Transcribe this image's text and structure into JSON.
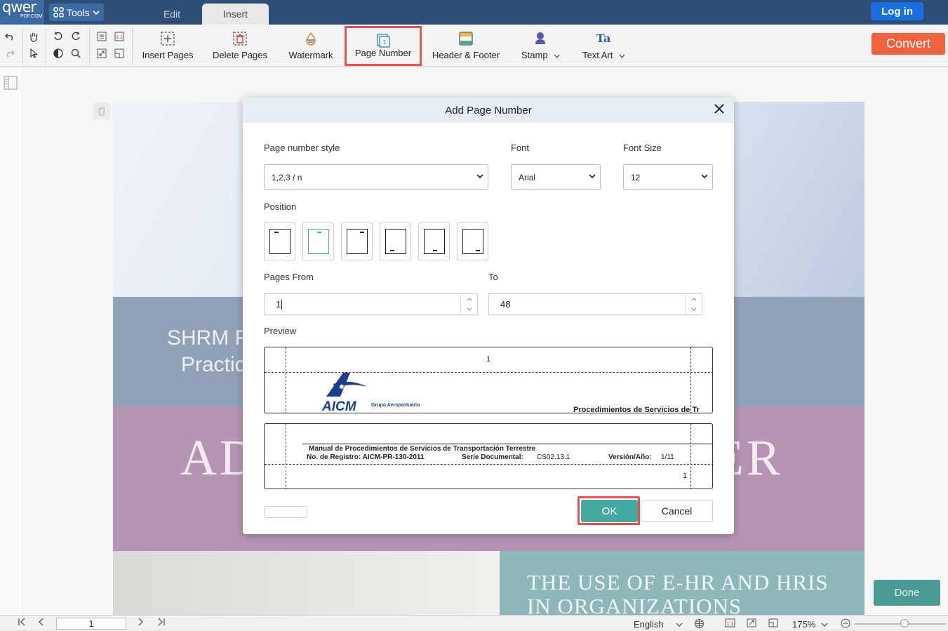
{
  "app": {
    "logo_text": "qwer",
    "logo_sub": "PDF.COM",
    "tools_label": "Tools",
    "tabs": [
      {
        "label": "Edit"
      },
      {
        "label": "Insert"
      }
    ],
    "login_label": "Log in",
    "convert_label": "Convert"
  },
  "toolbar": {
    "insert_pages": "Insert Pages",
    "delete_pages": "Delete Pages",
    "watermark": "Watermark",
    "page_number": "Page Number",
    "header_footer": "Header & Footer",
    "stamp": "Stamp",
    "text_art": "Text Art",
    "text_art_icon_text": "Ta"
  },
  "document": {
    "shrm_line1": "SHRM F",
    "shrm_line2": "Practic",
    "ad_text": "AD",
    "er_text": "ER",
    "ehr_line1": "THE USE OF E-HR AND HRIS",
    "ehr_line2": "IN ORGANIZATIONS"
  },
  "dialog": {
    "title": "Add Page Number",
    "style_label": "Page number style",
    "style_value": "1,2,3 / n",
    "font_label": "Font",
    "font_value": "Arial",
    "size_label": "Font Size",
    "size_value": "12",
    "position_label": "Position",
    "pages_from_label": "Pages From",
    "pages_from_value": "1",
    "to_label": "To",
    "to_value": "48",
    "preview_label": "Preview",
    "preview_top_number": "1",
    "preview_top_logo": "AICM",
    "preview_top_logo_sub": "Grupo Aeroportuario",
    "preview_top_heading": "Procedimientos de Servicios de Tr",
    "preview_bottom_title": "Manual de Procedimientos de Servicios de Transportación Terrestre",
    "preview_bottom_reg": "No. de Registro: AICM-PR-130-2011",
    "preview_bottom_serie_label": "Serie Documental:",
    "preview_bottom_serie_value": "CS02.13.1",
    "preview_bottom_version_label": "Versión/Año:",
    "preview_bottom_version_value": "1/11",
    "preview_bottom_number": "1",
    "ok_label": "OK",
    "cancel_label": "Cancel"
  },
  "done_label": "Done",
  "statusbar": {
    "page_value": "1",
    "language": "English",
    "zoom": "175%"
  },
  "colors": {
    "accent_teal": "#44aaa0",
    "highlight_red": "#e05454",
    "convert_orange": "#f1623f",
    "topbar": "#2f4e76"
  }
}
